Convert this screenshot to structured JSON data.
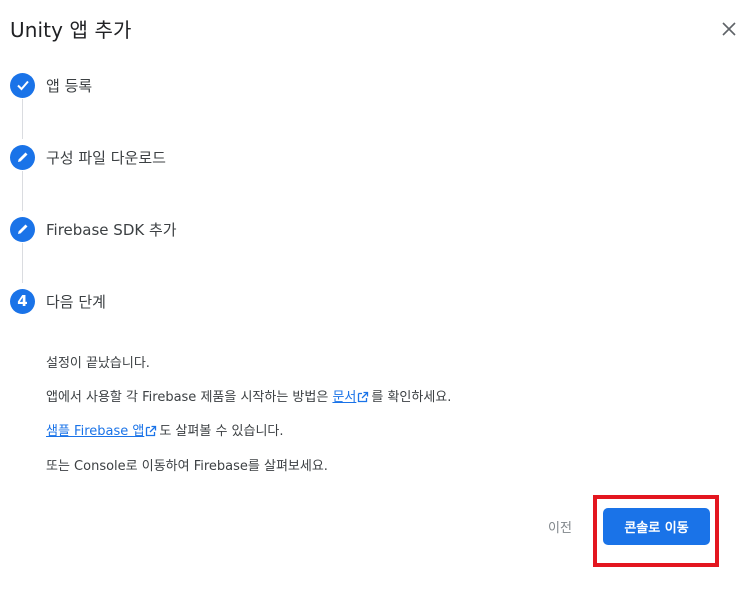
{
  "dialog": {
    "title": "Unity 앱 추가",
    "close_icon": "close-icon"
  },
  "steps": [
    {
      "label": "앱 등록",
      "state": "done",
      "icon": "check-icon"
    },
    {
      "label": "구성 파일 다운로드",
      "state": "edit",
      "icon": "pencil-icon"
    },
    {
      "label": "Firebase SDK 추가",
      "state": "edit",
      "icon": "pencil-icon"
    },
    {
      "label": "다음 단계",
      "state": "current",
      "number": "4"
    }
  ],
  "content": {
    "line1": "설정이 끝났습니다.",
    "line2_prefix": "앱에서 사용할 각 Firebase 제품을 시작하는 방법은 ",
    "line2_link": "문서",
    "line2_suffix": "를 확인하세요.",
    "line3_link": "샘플 Firebase 앱",
    "line3_suffix": "도 살펴볼 수 있습니다.",
    "line4": "또는 Console로 이동하여 Firebase를 살펴보세요."
  },
  "actions": {
    "prev_label": "이전",
    "primary_label": "콘솔로 이동"
  },
  "colors": {
    "accent": "#1a73e8",
    "highlight": "#e3161f"
  }
}
